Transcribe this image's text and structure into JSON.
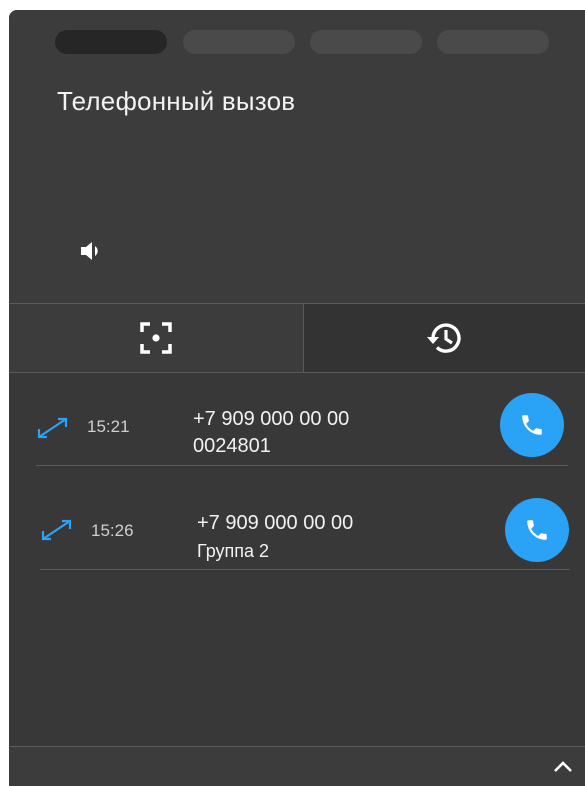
{
  "header": {
    "title": "Телефонный вызов",
    "step_pills": [
      "step-1",
      "step-2",
      "step-3",
      "step-4"
    ],
    "active_pill": 0
  },
  "icons": {
    "speaker": "speaker-icon",
    "screen_focus": "focus-frame-icon",
    "history": "history-icon",
    "direction": "bidirectional-arrow-icon",
    "phone": "phone-icon",
    "chevron": "chevron-up-icon"
  },
  "tabs": [
    {
      "name": "focus-tab",
      "icon": "focus-frame-icon"
    },
    {
      "name": "history-tab",
      "icon": "history-icon",
      "active": true
    }
  ],
  "calls": [
    {
      "time": "15:21",
      "number": "+7 909 000 00 00",
      "detail": "0024801"
    },
    {
      "time": "15:26",
      "number": "+7 909 000 00 00",
      "detail": "Группа 2"
    }
  ],
  "colors": {
    "accent": "#2aa2f5",
    "panel": "#383838",
    "text": "#f2f2f2"
  }
}
